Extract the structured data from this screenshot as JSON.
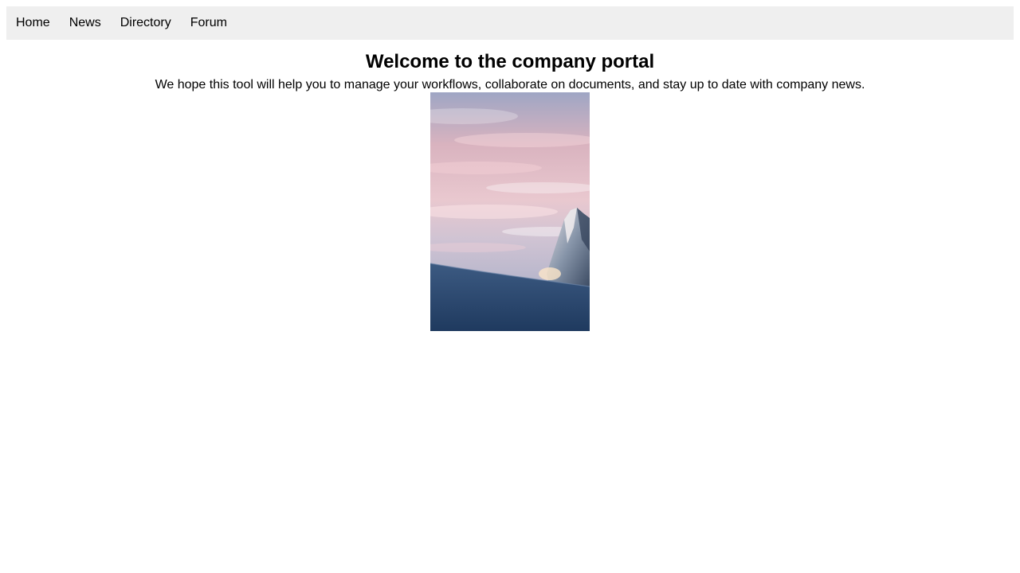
{
  "nav": {
    "items": [
      {
        "label": "Home"
      },
      {
        "label": "News"
      },
      {
        "label": "Directory"
      },
      {
        "label": "Forum"
      }
    ],
    "background": "#efefef"
  },
  "main": {
    "title": "Welcome to the company portal",
    "intro": "We hope this tool will help you to manage your workflows, collaborate on documents, and stay up to date with company news.",
    "image": {
      "subject": "snowy mountain peak under a pink sunset sky"
    }
  }
}
